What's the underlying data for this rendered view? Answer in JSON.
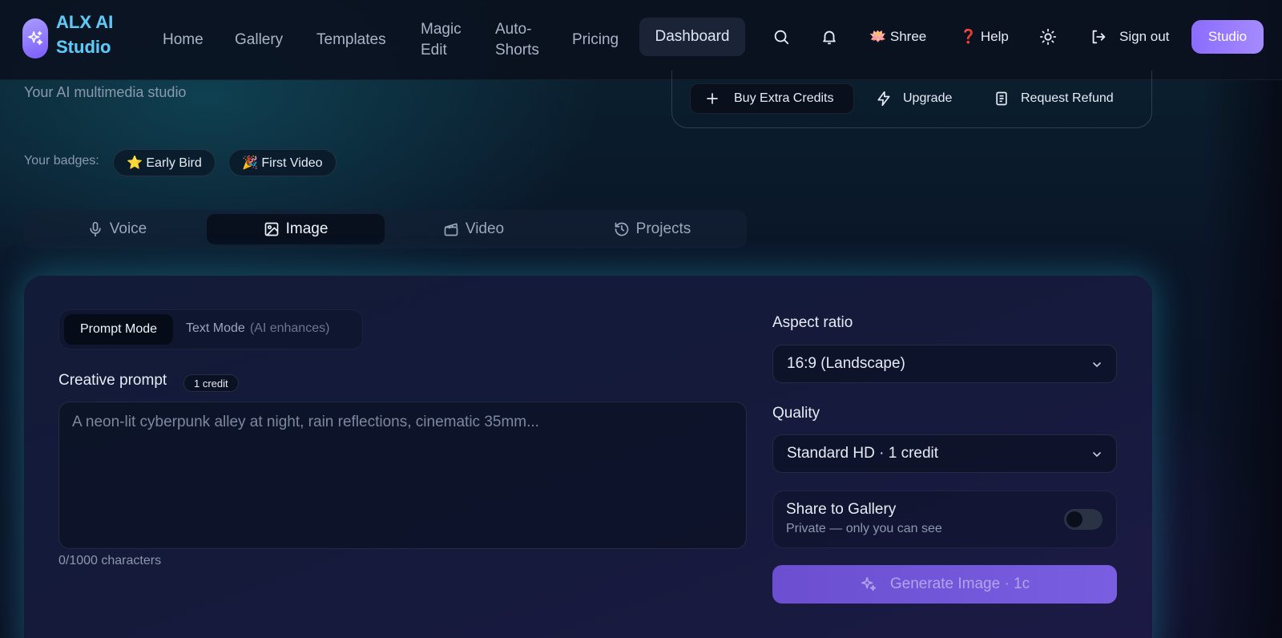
{
  "nav": {
    "brand": "ALX AI Studio",
    "links": [
      "Home",
      "Gallery",
      "Templates",
      "Magic Edit",
      "Auto-Shorts",
      "Pricing"
    ],
    "active_link": "Dashboard",
    "user": "🪷 Shree",
    "help": "❓ Help",
    "sign_out": "Sign out",
    "studio": "Studio"
  },
  "header": {
    "subtitle": "Your AI multimedia studio"
  },
  "credits_panel": {
    "buy": "Buy Extra Credits",
    "upgrade": "Upgrade",
    "refund": "Request Refund"
  },
  "badges": {
    "label": "Your badges:",
    "items": [
      "⭐ Early Bird",
      "🎉 First Video"
    ]
  },
  "tabs": [
    "Voice",
    "Image",
    "Video",
    "Projects"
  ],
  "active_tab": "Image",
  "form": {
    "mode_prompt": "Prompt Mode",
    "mode_text": "Text Mode",
    "mode_text_hint": "(AI enhances)",
    "prompt_label": "Creative prompt",
    "prompt_credit": "1 credit",
    "prompt_placeholder": "A neon-lit cyberpunk alley at night, rain reflections, cinematic 35mm...",
    "prompt_value": "",
    "char_count": "0/1000 characters",
    "aspect_label": "Aspect ratio",
    "aspect_value": "16:9 (Landscape)",
    "quality_label": "Quality",
    "quality_value": "Standard HD · 1 credit",
    "share_title": "Share to Gallery",
    "share_sub": "Private — only you can see",
    "share_enabled": false,
    "generate": "Generate Image · 1c"
  },
  "colors": {
    "accent": "#8b6cff",
    "brand_text": "#5ec8f5",
    "glow": "#28aac8"
  }
}
